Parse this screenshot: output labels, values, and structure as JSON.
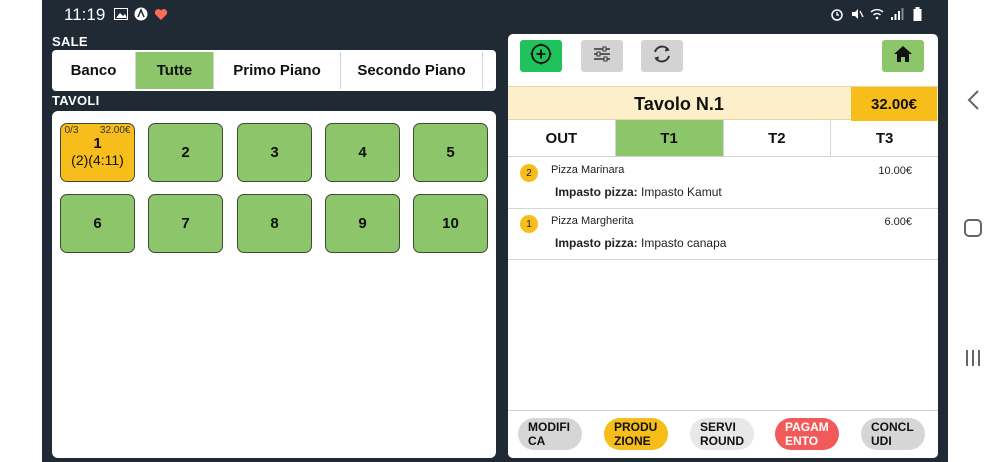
{
  "statusbar": {
    "time": "11:19"
  },
  "sale": {
    "label": "SALE",
    "tabs": [
      {
        "label": "Banco",
        "active": false
      },
      {
        "label": "Tutte",
        "active": true
      },
      {
        "label": "Primo Piano",
        "active": false
      },
      {
        "label": "Secondo Piano",
        "active": false
      }
    ]
  },
  "tavoli": {
    "label": "TAVOLI",
    "tables": [
      {
        "number": "1",
        "busy": true,
        "covers": "0/3",
        "total": "32.00€",
        "info": "(2)(4:11)"
      },
      {
        "number": "2",
        "busy": false
      },
      {
        "number": "3",
        "busy": false
      },
      {
        "number": "4",
        "busy": false
      },
      {
        "number": "5",
        "busy": false
      },
      {
        "number": "6",
        "busy": false
      },
      {
        "number": "7",
        "busy": false
      },
      {
        "number": "8",
        "busy": false
      },
      {
        "number": "9",
        "busy": false
      },
      {
        "number": "10",
        "busy": false
      }
    ]
  },
  "order": {
    "title": "Tavolo N.1",
    "total": "32.00€",
    "turns": [
      {
        "label": "OUT",
        "active": false
      },
      {
        "label": "T1",
        "active": true
      },
      {
        "label": "T2",
        "active": false
      },
      {
        "label": "T3",
        "active": false
      }
    ],
    "items": [
      {
        "qty": "2",
        "name": "Pizza Marinara",
        "price": "10.00€",
        "variant_label": "Impasto pizza:",
        "variant_value": "Impasto Kamut"
      },
      {
        "qty": "1",
        "name": "Pizza Margherita",
        "price": "6.00€",
        "variant_label": "Impasto pizza:",
        "variant_value": "Impasto canapa"
      }
    ]
  },
  "actions": {
    "modifica": "MODIFI\nCA",
    "produzione": "PRODU\nZIONE",
    "servi": "SERVI\nROUND",
    "pagamento": "PAGAM\nENTO",
    "concludi": "CONCL\nUDI"
  },
  "colors": {
    "green": "#8cc56a",
    "yellow": "#f7bd1a",
    "red": "#f25a5a",
    "bright_green": "#1fc25b",
    "background": "#1f2a35"
  },
  "icons": {
    "add": "plus-circle-icon",
    "filter": "sliders-icon",
    "refresh": "refresh-icon",
    "home": "home-icon"
  }
}
